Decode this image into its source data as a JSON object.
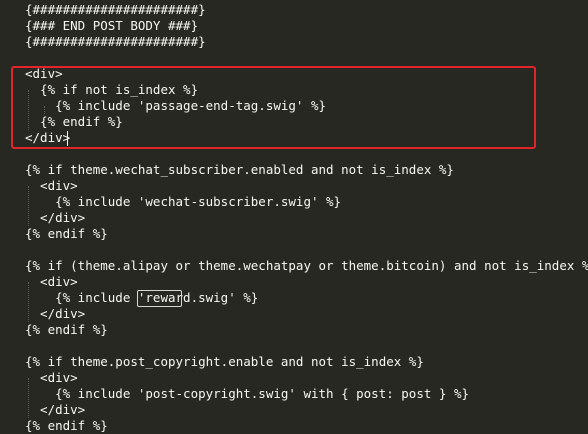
{
  "editor": {
    "lines": [
      "{######################}",
      "{### END POST BODY ###}",
      "{######################}",
      "",
      "<div>",
      "  {% if not is_index %}",
      "    {% include 'passage-end-tag.swig' %}",
      "  {% endif %}",
      "</div>",
      "",
      "{% if theme.wechat_subscriber.enabled and not is_index %}",
      "  <div>",
      "    {% include 'wechat-subscriber.swig' %}",
      "  </div>",
      "{% endif %}",
      "",
      "{% if (theme.alipay or theme.wechatpay or theme.bitcoin) and not is_index %}",
      "  <div>",
      "    {% include 'reward.swig' %}",
      "  </div>",
      "{% endif %}",
      "",
      "{% if theme.post_copyright.enable and not is_index %}",
      "  <div>",
      "    {% include 'post-copyright.swig' with { post: post } %}",
      "  </div>",
      "{% endif %}"
    ],
    "highlighted_word": "reward",
    "colors": {
      "background": "#272822",
      "foreground": "#f8f8f2",
      "annotation_box": "#e0262b"
    }
  }
}
